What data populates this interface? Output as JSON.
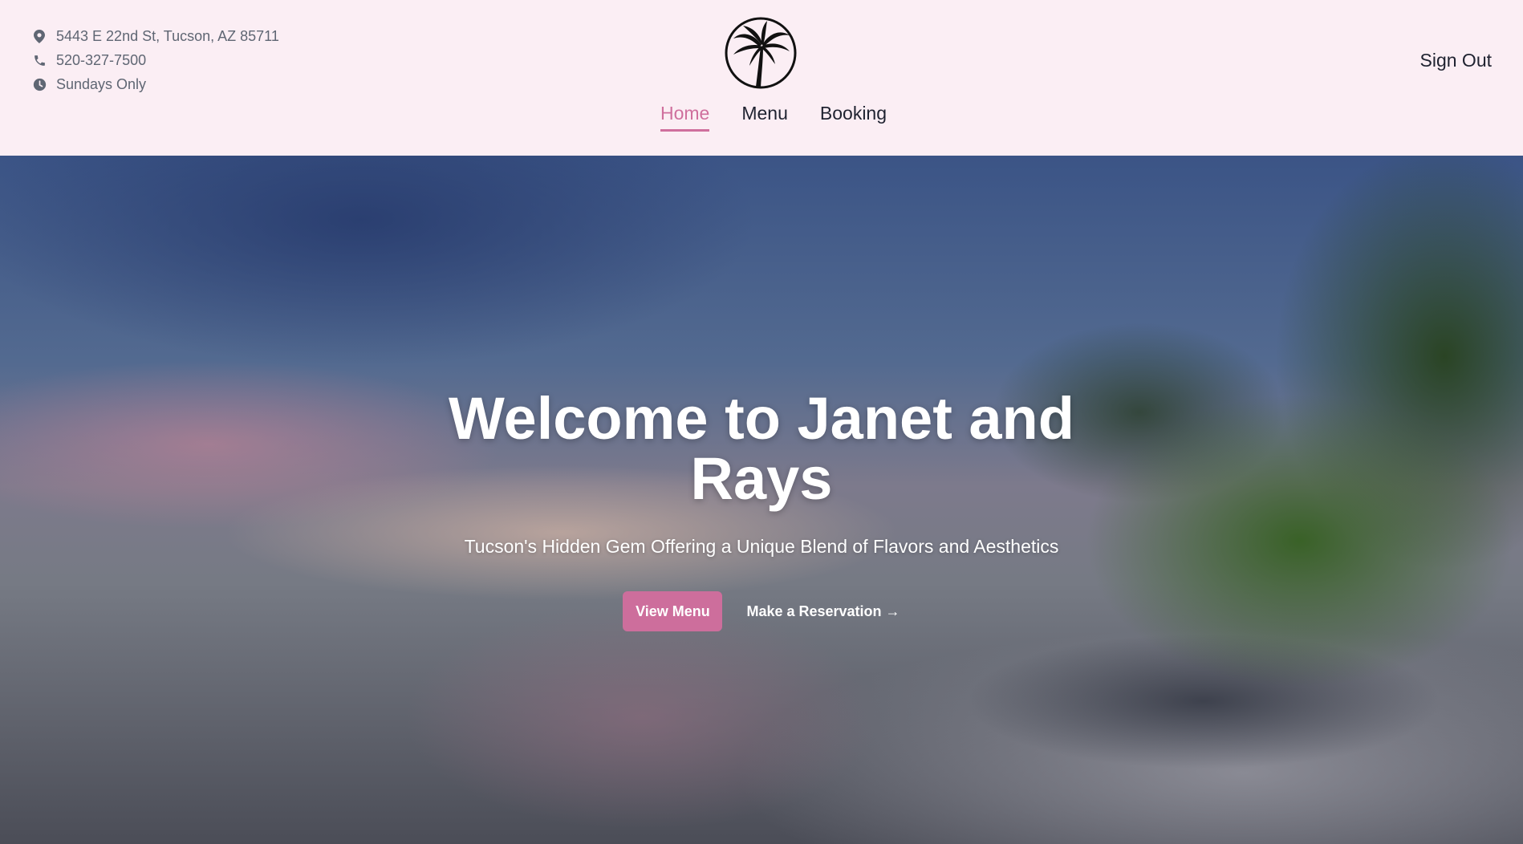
{
  "contact": {
    "address": "5443 E 22nd St, Tucson, AZ 85711",
    "phone": "520-327-7500",
    "hours": "Sundays Only"
  },
  "logo": {
    "icon": "palm-tree-icon"
  },
  "nav": {
    "items": [
      {
        "label": "Home",
        "active": true
      },
      {
        "label": "Menu",
        "active": false
      },
      {
        "label": "Booking",
        "active": false
      }
    ]
  },
  "auth": {
    "sign_out_label": "Sign Out"
  },
  "hero": {
    "title": "Welcome to Janet and Rays",
    "subtitle": "Tucson's Hidden Gem Offering a Unique Blend of Flavors and Aesthetics",
    "primary_button": "View Menu",
    "secondary_link": "Make a Reservation →"
  },
  "colors": {
    "accent": "#cd6e9c",
    "header_background": "#fbeef4",
    "text_dark": "#1f2230",
    "text_muted": "#5f6673"
  }
}
